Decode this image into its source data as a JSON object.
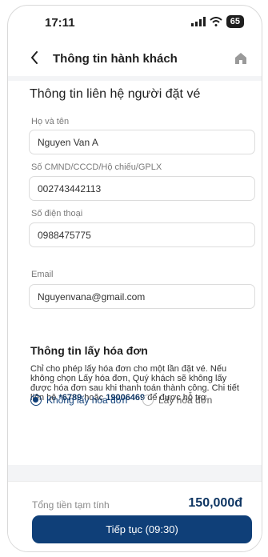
{
  "status_bar": {
    "time": "17:11",
    "battery": "65"
  },
  "header": {
    "title": "Thông tin hành khách",
    "back_icon": "chevron-left-icon",
    "home_icon": "home-icon"
  },
  "contact": {
    "title": "Thông tin liên hệ người đặt vé",
    "fields": [
      {
        "label": "Họ và tên",
        "value": "Nguyen Van A"
      },
      {
        "label": "Số CMND/CCCD/Hộ chiếu/GPLX",
        "value": "002743442113"
      },
      {
        "label": "Số điện thoại",
        "value": "0988475775"
      },
      {
        "label": "Email",
        "value": "Nguyenvana@gmail.com"
      }
    ]
  },
  "invoice": {
    "title": "Thông tin lấy hóa đơn",
    "desc_part1": "Chỉ cho phép lấy hóa đơn cho một lần đặt vé. Nếu không chọn Lấy hóa đơn, Quý khách sẽ không lấy được hóa đơn sau khi thanh toán thành công. Chi tiết liên hệ ",
    "hotline1": "*6789",
    "desc_part2": " hoặc ",
    "hotline2": "19006469",
    "desc_part3": " để được hỗ trợ",
    "options": [
      {
        "label": "Không lấy hóa đơn",
        "selected": true
      },
      {
        "label": "Lấy hóa đơn",
        "selected": false
      }
    ]
  },
  "footer": {
    "total_label": "Tổng tiền tạm tính",
    "total_value": "150,000đ",
    "continue_label": "Tiếp tục (09:30)"
  },
  "colors": {
    "primary": "#0f3f78",
    "price": "#0f3663",
    "background_band": "#f3f4f6"
  }
}
